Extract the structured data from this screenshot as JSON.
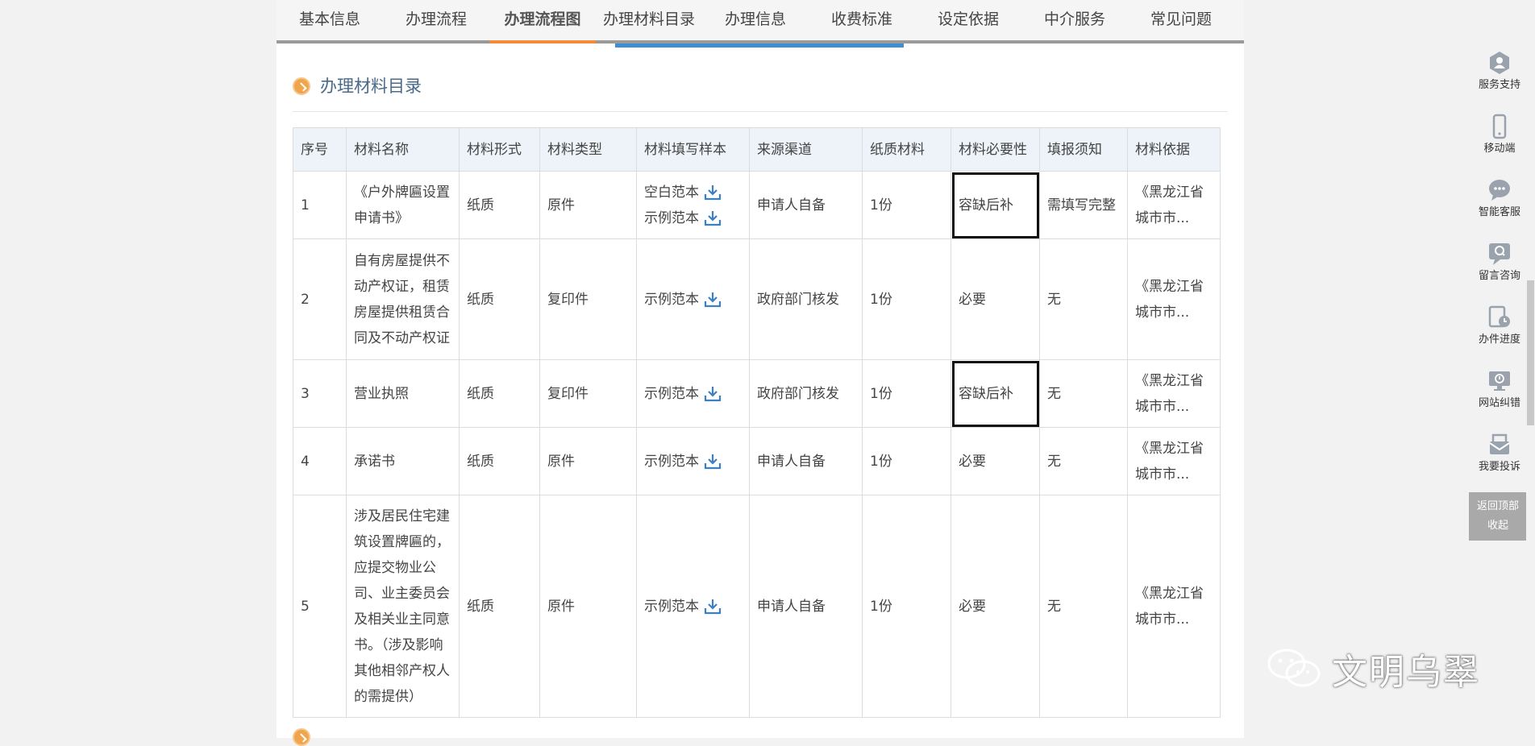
{
  "tabs": [
    {
      "label": "基本信息",
      "active": false
    },
    {
      "label": "办理流程",
      "active": false
    },
    {
      "label": "办理流程图",
      "active": true
    },
    {
      "label": "办理材料目录",
      "active": false
    },
    {
      "label": "办理信息",
      "active": false
    },
    {
      "label": "收费标准",
      "active": false
    },
    {
      "label": "设定依据",
      "active": false
    },
    {
      "label": "中介服务",
      "active": false
    },
    {
      "label": "常见问题",
      "active": false
    }
  ],
  "section": {
    "title": "办理材料目录"
  },
  "table": {
    "headers": [
      "序号",
      "材料名称",
      "材料形式",
      "材料类型",
      "材料填写样本",
      "来源渠道",
      "纸质材料",
      "材料必要性",
      "填报须知",
      "材料依据"
    ],
    "rows": [
      {
        "no": "1",
        "name": "《户外牌匾设置申请书》",
        "form": "纸质",
        "type": "原件",
        "samples": [
          "空白范本",
          "示例范本"
        ],
        "source": "申请人自备",
        "paper": "1份",
        "necessity": "容缺后补",
        "notice": "需填写完整",
        "basis": "《黑龙江省城市市..."
      },
      {
        "no": "2",
        "name": "自有房屋提供不动产权证，租赁房屋提供租赁合同及不动产权证",
        "form": "纸质",
        "type": "复印件",
        "samples": [
          "示例范本"
        ],
        "source": "政府部门核发",
        "paper": "1份",
        "necessity": "必要",
        "notice": "无",
        "basis": "《黑龙江省城市市..."
      },
      {
        "no": "3",
        "name": "营业执照",
        "form": "纸质",
        "type": "复印件",
        "samples": [
          "示例范本"
        ],
        "source": "政府部门核发",
        "paper": "1份",
        "necessity": "容缺后补",
        "notice": "无",
        "basis": "《黑龙江省城市市..."
      },
      {
        "no": "4",
        "name": "承诺书",
        "form": "纸质",
        "type": "原件",
        "samples": [
          "示例范本"
        ],
        "source": "申请人自备",
        "paper": "1份",
        "necessity": "必要",
        "notice": "无",
        "basis": "《黑龙江省城市市..."
      },
      {
        "no": "5",
        "name": "涉及居民住宅建筑设置牌匾的，应提交物业公司、业主委员会及相关业主同意书。（涉及影响其他相邻产权人的需提供）",
        "form": "纸质",
        "type": "原件",
        "samples": [
          "示例范本"
        ],
        "source": "申请人自备",
        "paper": "1份",
        "necessity": "必要",
        "notice": "无",
        "basis": "《黑龙江省城市市..."
      }
    ]
  },
  "sidebar": [
    {
      "label": "服务支持",
      "icon": "service-support-icon"
    },
    {
      "label": "移动端",
      "icon": "mobile-icon"
    },
    {
      "label": "智能客服",
      "icon": "chat-icon"
    },
    {
      "label": "留言咨询",
      "icon": "message-icon"
    },
    {
      "label": "办件进度",
      "icon": "progress-icon"
    },
    {
      "label": "网站纠错",
      "icon": "monitor-icon"
    },
    {
      "label": "我要投诉",
      "icon": "complaint-icon"
    }
  ],
  "back": {
    "top": "返回顶部",
    "collapse": "收起"
  },
  "watermark": {
    "text": "文明乌翠"
  }
}
